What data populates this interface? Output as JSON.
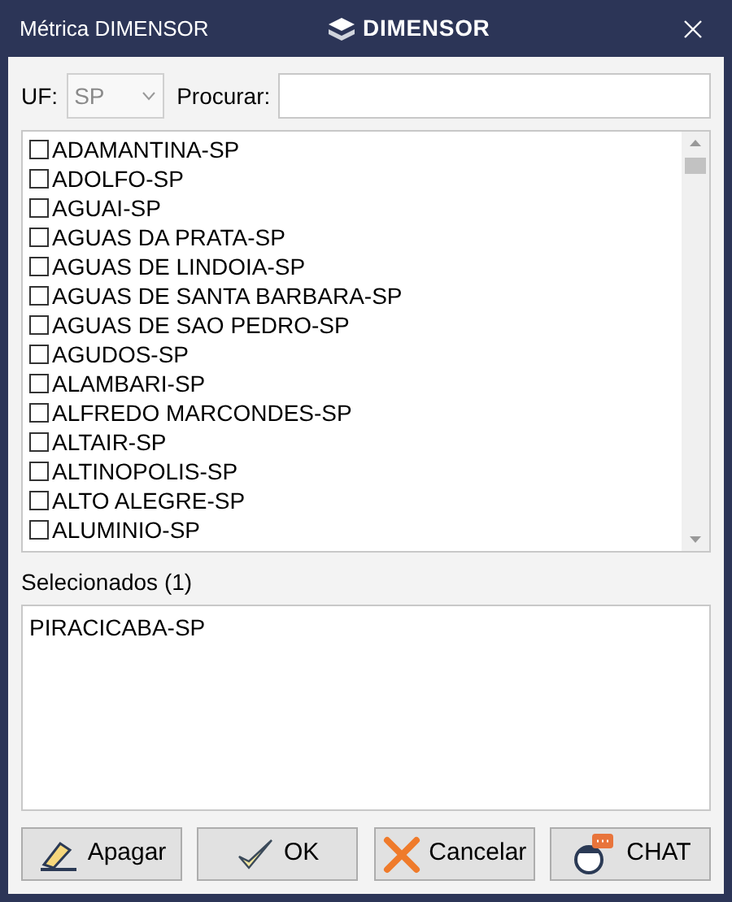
{
  "window": {
    "title": "Métrica DIMENSOR",
    "brand": "DIMENSOR"
  },
  "filter": {
    "uf_label": "UF:",
    "uf_value": "SP",
    "search_label": "Procurar:"
  },
  "cities": [
    {
      "label": "ADAMANTINA-SP",
      "checked": false
    },
    {
      "label": "ADOLFO-SP",
      "checked": false
    },
    {
      "label": "AGUAI-SP",
      "checked": false
    },
    {
      "label": "AGUAS DA PRATA-SP",
      "checked": false
    },
    {
      "label": "AGUAS DE LINDOIA-SP",
      "checked": false
    },
    {
      "label": "AGUAS DE SANTA BARBARA-SP",
      "checked": false
    },
    {
      "label": "AGUAS DE SAO PEDRO-SP",
      "checked": false
    },
    {
      "label": "AGUDOS-SP",
      "checked": false
    },
    {
      "label": "ALAMBARI-SP",
      "checked": false
    },
    {
      "label": "ALFREDO MARCONDES-SP",
      "checked": false
    },
    {
      "label": "ALTAIR-SP",
      "checked": false
    },
    {
      "label": "ALTINOPOLIS-SP",
      "checked": false
    },
    {
      "label": "ALTO ALEGRE-SP",
      "checked": false
    },
    {
      "label": "ALUMINIO-SP",
      "checked": false
    }
  ],
  "selected": {
    "label": "Selecionados (1)",
    "items": [
      "PIRACICABA-SP"
    ]
  },
  "buttons": [
    {
      "kind": "erase",
      "label": "Apagar"
    },
    {
      "kind": "ok",
      "label": "OK"
    },
    {
      "kind": "cancel",
      "label": "Cancelar"
    },
    {
      "kind": "chat",
      "label": "CHAT"
    }
  ]
}
